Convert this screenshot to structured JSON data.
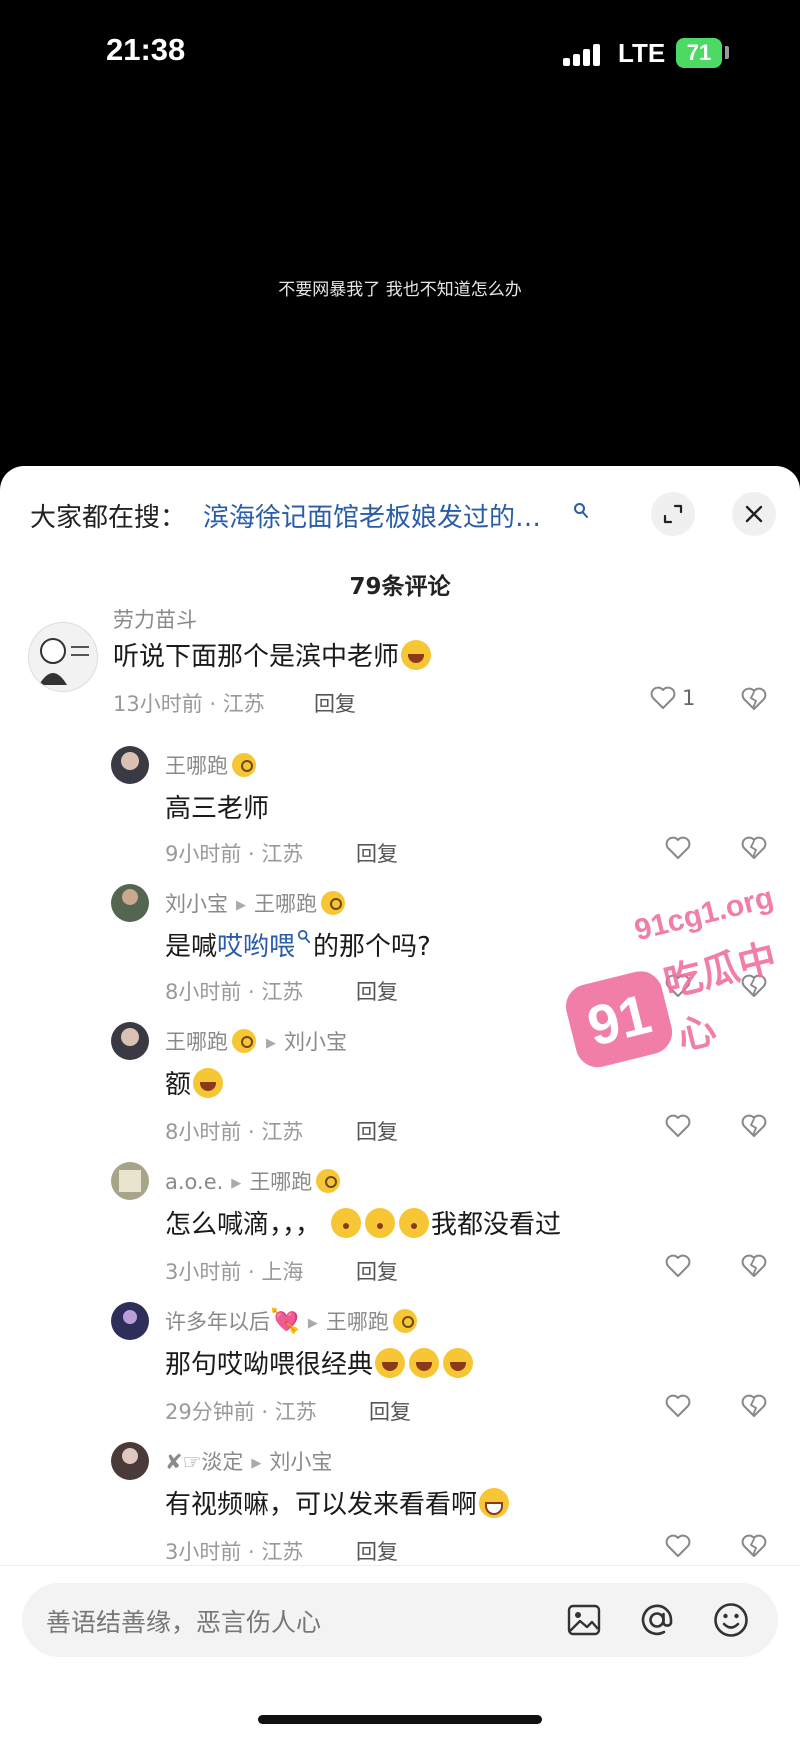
{
  "status_bar": {
    "time": "21:38",
    "network": "LTE",
    "battery": "71"
  },
  "video": {
    "subtitle": "不要网暴我了 我也不知道怎么办"
  },
  "sheet": {
    "search_label": "大家都在搜：",
    "search_query": "滨海徐记面馆老板娘发过的…",
    "comment_count": "79条评论"
  },
  "comments": [
    {
      "user": "劳力苗斗",
      "text": "听说下面那个是滨中老师",
      "meta": "13小时前 · 江苏",
      "reply": "回复",
      "likes": "1"
    },
    {
      "user": "王哪跑",
      "text": "高三老师",
      "meta": "9小时前 · 江苏",
      "reply": "回复"
    },
    {
      "user": "刘小宝",
      "reply_to": "王哪跑",
      "text_before": "是喊",
      "text_link": "哎哟喂",
      "text_after": "的那个吗?",
      "meta": "8小时前 · 江苏",
      "reply": "回复"
    },
    {
      "user": "王哪跑",
      "reply_to": "刘小宝",
      "text": "额",
      "meta": "8小时前 · 江苏",
      "reply": "回复"
    },
    {
      "user": "a.o.e.",
      "reply_to": "王哪跑",
      "text_before": "怎么喊滴，，，",
      "text_after": "我都没看过",
      "meta": "3小时前 · 上海",
      "reply": "回复"
    },
    {
      "user": "许多年以后",
      "reply_to": "王哪跑",
      "text": "那句哎呦喂很经典",
      "meta": "29分钟前 · 江苏",
      "reply": "回复"
    },
    {
      "user": "✘☞淡定",
      "reply_to": "刘小宝",
      "text": "有视频嘛，可以发来看看啊",
      "meta": "3小时前 · 江苏",
      "reply": "回复"
    }
  ],
  "input": {
    "placeholder": "善语结善缘，恶言伤人心"
  },
  "watermark": {
    "badge": "91",
    "domain": "91cg1.org",
    "name": "吃瓜中心"
  },
  "colors": {
    "link": "#2a5ca8",
    "battery": "#4cd964",
    "watermark": "#f06fa0"
  },
  "icons": [
    "search-icon",
    "expand-icon",
    "close-icon",
    "heart-icon",
    "dislike-icon",
    "image-icon",
    "at-icon",
    "emoji-icon"
  ]
}
